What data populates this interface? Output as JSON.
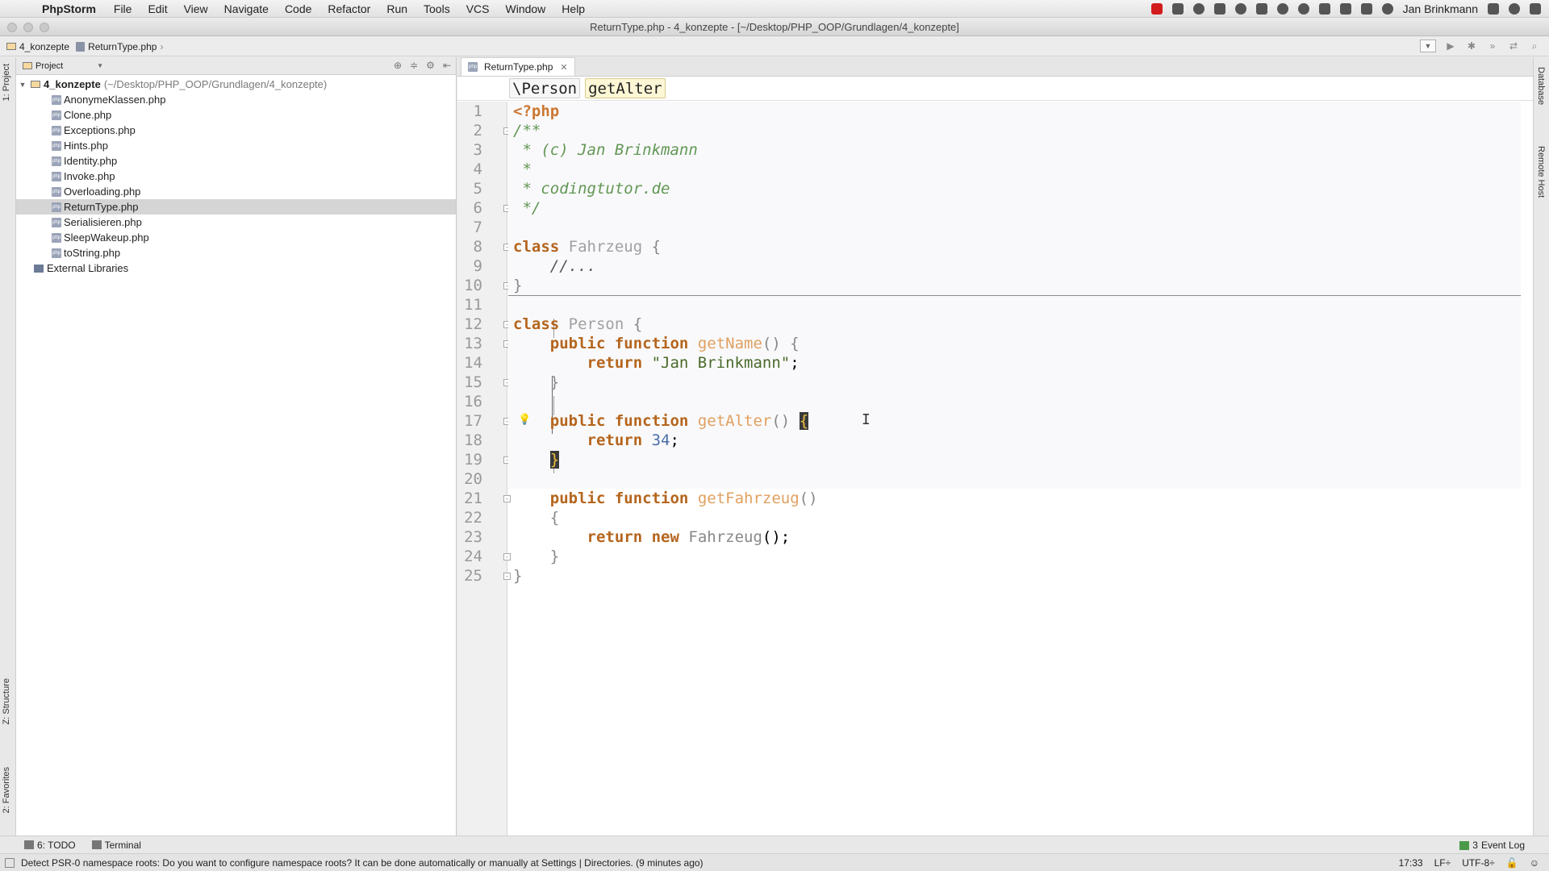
{
  "menubar": {
    "app_name": "PhpStorm",
    "items": [
      "File",
      "Edit",
      "View",
      "Navigate",
      "Code",
      "Refactor",
      "Run",
      "Tools",
      "VCS",
      "Window",
      "Help"
    ],
    "user": "Jan Brinkmann"
  },
  "window": {
    "title": "ReturnType.php - 4_konzepte - [~/Desktop/PHP_OOP/Grundlagen/4_konzepte]"
  },
  "navbar": {
    "crumbs": [
      "4_konzepte",
      "ReturnType.php"
    ]
  },
  "left_strip": {
    "project_tab": "1: Project",
    "structure_tab": "Z: Structure",
    "favorites_tab": "2: Favorites"
  },
  "project_panel": {
    "selector": "Project",
    "root": {
      "name": "4_konzepte",
      "path": "(~/Desktop/PHP_OOP/Grundlagen/4_konzepte)"
    },
    "files": [
      "AnonymeKlassen.php",
      "Clone.php",
      "Exceptions.php",
      "Hints.php",
      "Identity.php",
      "Invoke.php",
      "Overloading.php",
      "ReturnType.php",
      "Serialisieren.php",
      "SleepWakeup.php",
      "toString.php"
    ],
    "selected_file": "ReturnType.php",
    "external": "External Libraries"
  },
  "editor": {
    "tab": "ReturnType.php",
    "breadcrumbs": [
      "\\Person",
      "getAlter"
    ],
    "line_count": 25
  },
  "right_strip": {
    "database_tab": "Database",
    "remote_tab": "Remote Host"
  },
  "bottom_tools": {
    "todo": "6: TODO",
    "terminal": "Terminal",
    "event_log": "Event Log",
    "event_count": "3"
  },
  "status": {
    "message": "Detect PSR-0 namespace roots: Do you want to configure namespace roots? It can be done automatically or manually at Settings | Directories. (9 minutes ago)",
    "position": "17:33",
    "line_sep": "LF÷",
    "encoding": "UTF-8÷"
  }
}
